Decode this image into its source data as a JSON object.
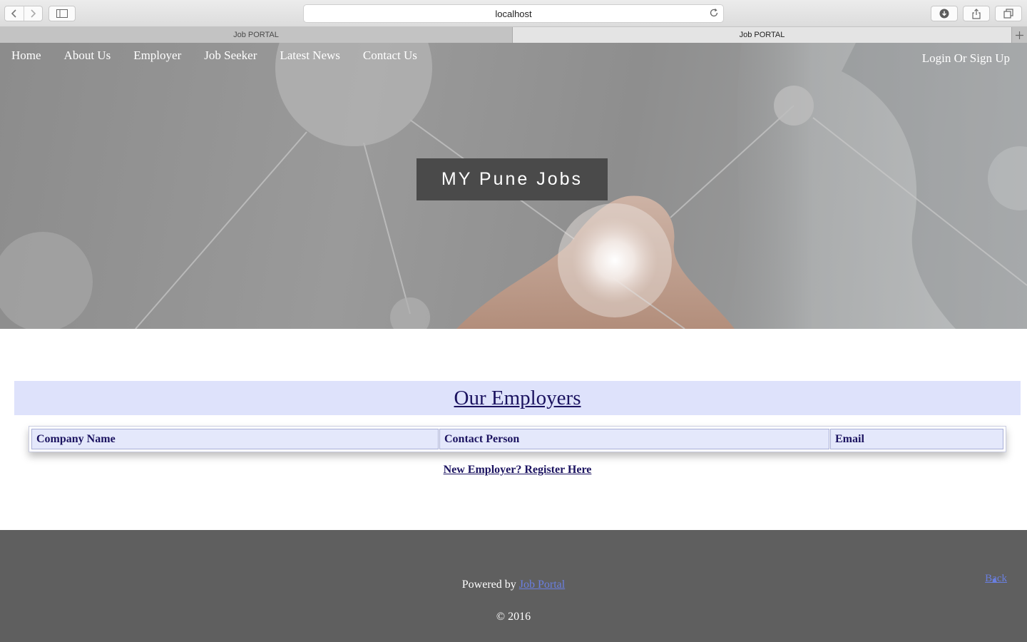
{
  "browser": {
    "address": "localhost",
    "tabs": [
      {
        "label": "Job PORTAL",
        "active": false
      },
      {
        "label": "Job PORTAL",
        "active": true
      }
    ],
    "icons": {
      "back": "chevron-left-icon",
      "forward": "chevron-right-icon",
      "sidebar": "sidebar-icon",
      "reload": "reload-icon",
      "download": "download-icon",
      "share": "share-icon",
      "tabs": "tabs-icon",
      "new_tab": "plus-icon"
    }
  },
  "nav": {
    "items": [
      {
        "label": "Home"
      },
      {
        "label": "About Us"
      },
      {
        "label": "Employer"
      },
      {
        "label": "Job Seeker"
      },
      {
        "label": "Latest News"
      },
      {
        "label": "Contact Us"
      }
    ],
    "login": "Login Or Sign Up"
  },
  "hero": {
    "brand": "MY Pune Jobs"
  },
  "employers": {
    "heading": "Our Employers",
    "columns": [
      "Company Name",
      "Contact Person",
      "Email"
    ],
    "register_link": "New Employer? Register Here"
  },
  "footer": {
    "powered_prefix": "Powered by",
    "powered_link": "Job Portal",
    "copyright": "© 2016",
    "back": "Back"
  },
  "colors": {
    "heading_bar": "#dee2fb",
    "heading_text": "#1b1360",
    "footer_bg": "#5f5f5f",
    "link": "#6a7fe0",
    "brand_box": "#4a4a4a"
  }
}
